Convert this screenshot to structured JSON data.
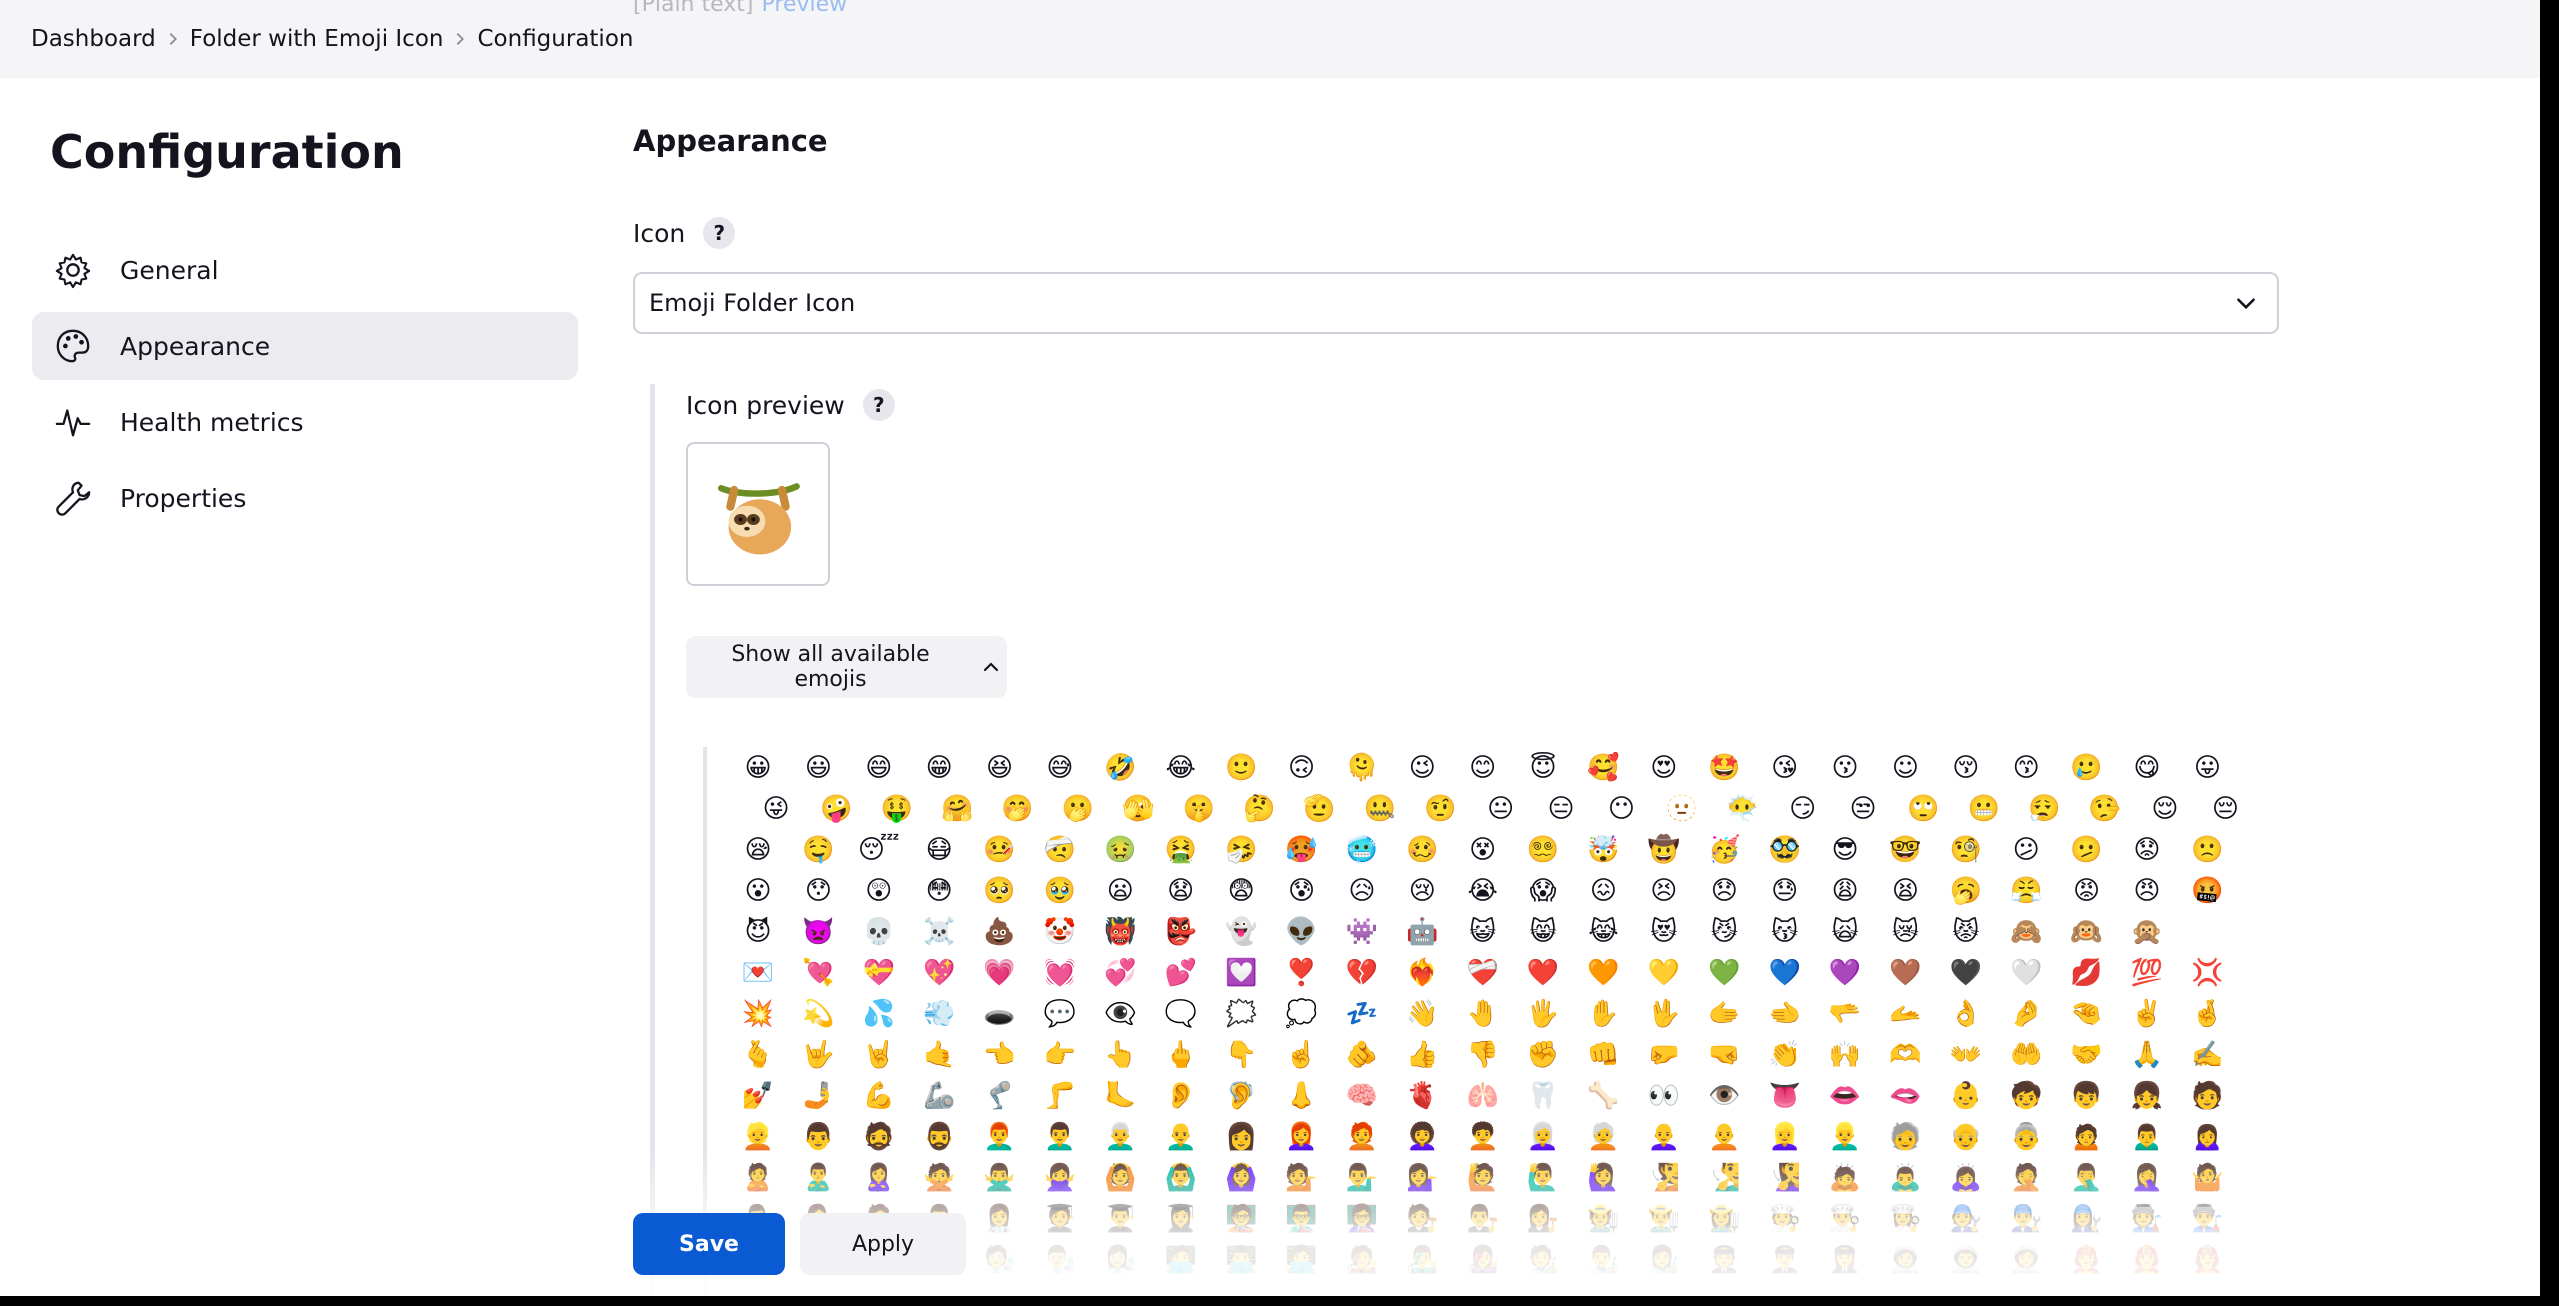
{
  "breadcrumbs": [
    "Dashboard",
    "Folder with Emoji Icon",
    "Configuration"
  ],
  "ghost_text": {
    "type_label": "[Plain text]",
    "preview_link": "Preview"
  },
  "sidebar": {
    "title": "Configuration",
    "items": [
      {
        "label": "General",
        "icon": "gear-icon"
      },
      {
        "label": "Appearance",
        "icon": "palette-icon",
        "active": true
      },
      {
        "label": "Health metrics",
        "icon": "pulse-icon"
      },
      {
        "label": "Properties",
        "icon": "wrench-icon"
      }
    ]
  },
  "main": {
    "section_title": "Appearance",
    "icon_label": "Icon",
    "icon_select_value": "Emoji Folder Icon",
    "preview_label": "Icon preview",
    "preview_emoji": "sloth",
    "toggle_label": "Show all available emojis"
  },
  "emoji_rows": [
    "😀😃😄😁😆😅🤣😂🙂🙃🫠😉😊😇🥰😍🤩😘😗☺😚😙🥲😋😛",
    "😜🤪🤑🤗🤭🫢🫣🤫🤔🫡🤐🤨😐😑😶🫥😶‍🌫️😏😒🙄😬😮‍💨🤥😌😔",
    "😪🤤😴😷🤒🤕🤢🤮🤧🥵🥶🥴😵😵‍💫🤯🤠🥳🥸😎🤓🧐😕🫤😟🙁",
    "😮😯😲😳🥺🥹😦😧😨😰😥😢😭😱😖😣😞😓😩😫🥱😤😡😠🤬",
    "😈👿💀☠️💩🤡👹👺👻👽👾🤖😺😸😹😻😼😽🙀😿😾🙈🙉🙊",
    "💌💘💝💖💗💓💞💕💟❣️💔❤️‍🔥❤️‍🩹❤️🧡💛💚💙💜🤎🖤🤍💋💯💢",
    "💥💫💦💨🕳️💬👁️‍🗨️🗨️🗯️💭💤👋🤚🖐️✋🖖🫱🫲🫳🫴👌🤌🤏✌️🤞",
    "🫰🤟🤘🤙👈👉👆🖕👇☝️🫵👍👎✊👊🤛🤜👏🙌🫶👐🤲🤝🙏✍️",
    "💅🤳💪🦾🦿🦵🦶👂🦻👃🧠🫀🫁🦷🦴👀👁️👅👄🫦👶🧒👦👧🧑",
    "👱👨🧔🧔‍♂️👨‍🦰👨‍🦱👨‍🦳👨‍🦲👩👩‍🦰🧑‍🦰👩‍🦱🧑‍🦱👩‍🦳🧑‍🦳👩‍🦲🧑‍🦲👱‍♀️👱‍♂️🧓👴👵🙍🙍‍♂️🙍‍♀️",
    "🙎🙎‍♂️🙎‍♀️🙅🙅‍♂️🙅‍♀️🙆🙆‍♂️🙆‍♀️💁💁‍♂️💁‍♀️🙋🙋‍♂️🙋‍♀️🧏🧏‍♂️🧏‍♀️🙇🙇‍♂️🙇‍♀️🤦🤦‍♂️🤦‍♀️🤷",
    "🤷‍♂️🤷‍♀️🧑‍⚕️👨‍⚕️👩‍⚕️🧑‍🎓👨‍🎓👩‍🎓🧑‍🏫👨‍🏫👩‍🏫🧑‍⚖️👨‍⚖️👩‍⚖️🧑‍🌾👨‍🌾👩‍🌾🧑‍🍳👨‍🍳👩‍🍳🧑‍🔧👨‍🔧👩‍🔧🧑‍🏭👨‍🏭",
    "👩‍🏭🧑‍💼👨‍💼👩‍💼🧑‍🔬👨‍🔬👩‍🔬🧑‍💻👨‍💻👩‍💻🧑‍🎤👨‍🎤👩‍🎤🧑‍🎨👨‍🎨👩‍🎨🧑‍✈️👨‍✈️👩‍✈️🧑‍🚀👨‍🚀👩‍🚀🧑‍🚒👨‍🚒👩‍🚒"
  ],
  "actions": {
    "save_label": "Save",
    "apply_label": "Apply"
  },
  "colors": {
    "accent": "#0a5ad4",
    "topbar_bg": "#f5f5f7",
    "active_item_bg": "#ebebf0"
  }
}
